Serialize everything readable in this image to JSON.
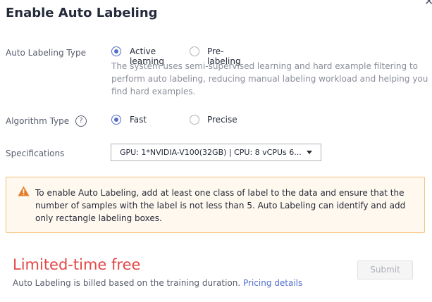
{
  "dialog": {
    "title": "Enable Auto Labeling",
    "close_icon": "close-icon"
  },
  "auto_labeling_type": {
    "label": "Auto Labeling Type",
    "options": [
      "Active learning",
      "Pre-labeling"
    ],
    "selected": "Active learning",
    "description": "The system uses semi-supervised learning and hard example filtering to perform auto labeling, reducing manual labeling workload and helping you find hard examples."
  },
  "algorithm_type": {
    "label": "Algorithm Type",
    "help_icon": "question-icon",
    "help_glyph": "?",
    "options": [
      "Fast",
      "Precise"
    ],
    "selected": "Fast"
  },
  "specifications": {
    "label": "Specifications",
    "value": "GPU: 1*NVIDIA-V100(32GB) | CPU: 8 vCPUs 6..."
  },
  "alert": {
    "icon": "warning-icon",
    "text": "To enable Auto Labeling, add at least one class of label to the data and ensure that the number of samples with the label is not less than 5. Auto Labeling can identify and add only rectangle labeling boxes."
  },
  "footer": {
    "promo": "Limited-time free",
    "billing_text": "Auto Labeling is billed based on the training duration.",
    "pricing_link": "Pricing details",
    "submit_label": "Submit"
  },
  "colors": {
    "accent": "#526ecc",
    "warning": "#e37d29",
    "promo": "#e54545"
  }
}
